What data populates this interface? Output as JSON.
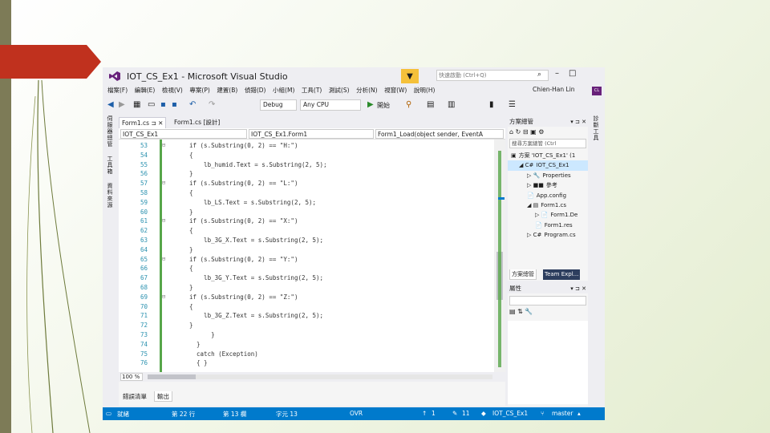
{
  "window": {
    "title": "IOT_CS_Ex1 - Microsoft Visual Studio",
    "quick_launch_placeholder": "快速啟動 (Ctrl+Q)",
    "user": "Chien-Han Lin",
    "user_badge": "CL"
  },
  "menu": [
    "檔案(F)",
    "編輯(E)",
    "檢視(V)",
    "專案(P)",
    "建置(B)",
    "偵錯(D)",
    "小組(M)",
    "工具(T)",
    "測試(S)",
    "分析(N)",
    "視窗(W)",
    "說明(H)"
  ],
  "toolbar": {
    "config": "Debug",
    "platform": "Any CPU",
    "start": "開始"
  },
  "left_tabs": [
    "伺服器總管",
    "工具箱",
    "資料來源"
  ],
  "right_tabs": [
    "診斷工具"
  ],
  "doc_tabs": [
    {
      "label": "Form1.cs",
      "pin": "⊐ ✕"
    },
    {
      "label": "Form1.cs [設計]"
    }
  ],
  "nav": {
    "project": "IOT_CS_Ex1",
    "class": "IOT_CS_Ex1.Form1",
    "member": "Form1_Load(object sender, EventA"
  },
  "code": {
    "lines": [
      {
        "n": "53",
        "fold": "⊟",
        "text": "if (s.Substring(0, 2) == \"H:\")"
      },
      {
        "n": "54",
        "fold": "",
        "text": "{"
      },
      {
        "n": "55",
        "fold": "",
        "text": "    lb_humid.Text = s.Substring(2, 5);"
      },
      {
        "n": "56",
        "fold": "",
        "text": "}"
      },
      {
        "n": "57",
        "fold": "⊟",
        "text": "if (s.Substring(0, 2) == \"L:\")"
      },
      {
        "n": "58",
        "fold": "",
        "text": "{"
      },
      {
        "n": "59",
        "fold": "",
        "text": "    lb_LS.Text = s.Substring(2, 5);"
      },
      {
        "n": "60",
        "fold": "",
        "text": "}"
      },
      {
        "n": "61",
        "fold": "⊟",
        "text": "if (s.Substring(0, 2) == \"X:\")"
      },
      {
        "n": "62",
        "fold": "",
        "text": "{"
      },
      {
        "n": "63",
        "fold": "",
        "text": "    lb_3G_X.Text = s.Substring(2, 5);"
      },
      {
        "n": "64",
        "fold": "",
        "text": "}"
      },
      {
        "n": "65",
        "fold": "⊟",
        "text": "if (s.Substring(0, 2) == \"Y:\")"
      },
      {
        "n": "66",
        "fold": "",
        "text": "{"
      },
      {
        "n": "67",
        "fold": "",
        "text": "    lb_3G_Y.Text = s.Substring(2, 5);"
      },
      {
        "n": "68",
        "fold": "",
        "text": "}"
      },
      {
        "n": "69",
        "fold": "⊟",
        "text": "if (s.Substring(0, 2) == \"Z:\")"
      },
      {
        "n": "70",
        "fold": "",
        "text": "{"
      },
      {
        "n": "71",
        "fold": "",
        "text": "    lb_3G_Z.Text = s.Substring(2, 5);"
      },
      {
        "n": "72",
        "fold": "",
        "text": "}"
      },
      {
        "n": "73",
        "fold": "",
        "text": "      }"
      },
      {
        "n": "74",
        "fold": "",
        "text": "  }"
      },
      {
        "n": "75",
        "fold": "",
        "text": "  catch (Exception)"
      },
      {
        "n": "76",
        "fold": "",
        "text": "  { }"
      }
    ]
  },
  "zoom": "100 %",
  "output_tabs": [
    "錯誤清單",
    "輸出"
  ],
  "solution_explorer": {
    "title": "方案總管",
    "search_placeholder": "搜尋方案總管 (Ctrl",
    "nodes": [
      {
        "text": "方案 'IOT_CS_Ex1' (1",
        "indent": 0,
        "icon": "▣"
      },
      {
        "text": "IOT_CS_Ex1",
        "indent": 1,
        "icon": "◢ C#"
      },
      {
        "text": "Properties",
        "indent": 2,
        "icon": "▷ 🔧"
      },
      {
        "text": "參考",
        "indent": 2,
        "icon": "▷ ■■"
      },
      {
        "text": "App.config",
        "indent": 2,
        "icon": "  📄"
      },
      {
        "text": "Form1.cs",
        "indent": 2,
        "icon": "◢ ▤"
      },
      {
        "text": "Form1.De",
        "indent": 3,
        "icon": "▷ 📄"
      },
      {
        "text": "Form1.res",
        "indent": 3,
        "icon": "  📄"
      },
      {
        "text": "Program.cs",
        "indent": 2,
        "icon": "▷ C#"
      }
    ],
    "tabs": [
      "方案總管",
      "Team Expl..."
    ]
  },
  "properties": {
    "title": "屬性"
  },
  "status": {
    "ready": "就緒",
    "row": "第 22 行",
    "col": "第 13 欄",
    "char": "字元 13",
    "mode": "OVR",
    "push": "1",
    "pencil": "11",
    "repo": "IOT_CS_Ex1",
    "branch": "master"
  },
  "colors": {
    "vs_purple": "#68217a",
    "status_blue": "#007acc",
    "slide_arrow": "#c0311e",
    "slide_bar": "#7d7b57"
  }
}
